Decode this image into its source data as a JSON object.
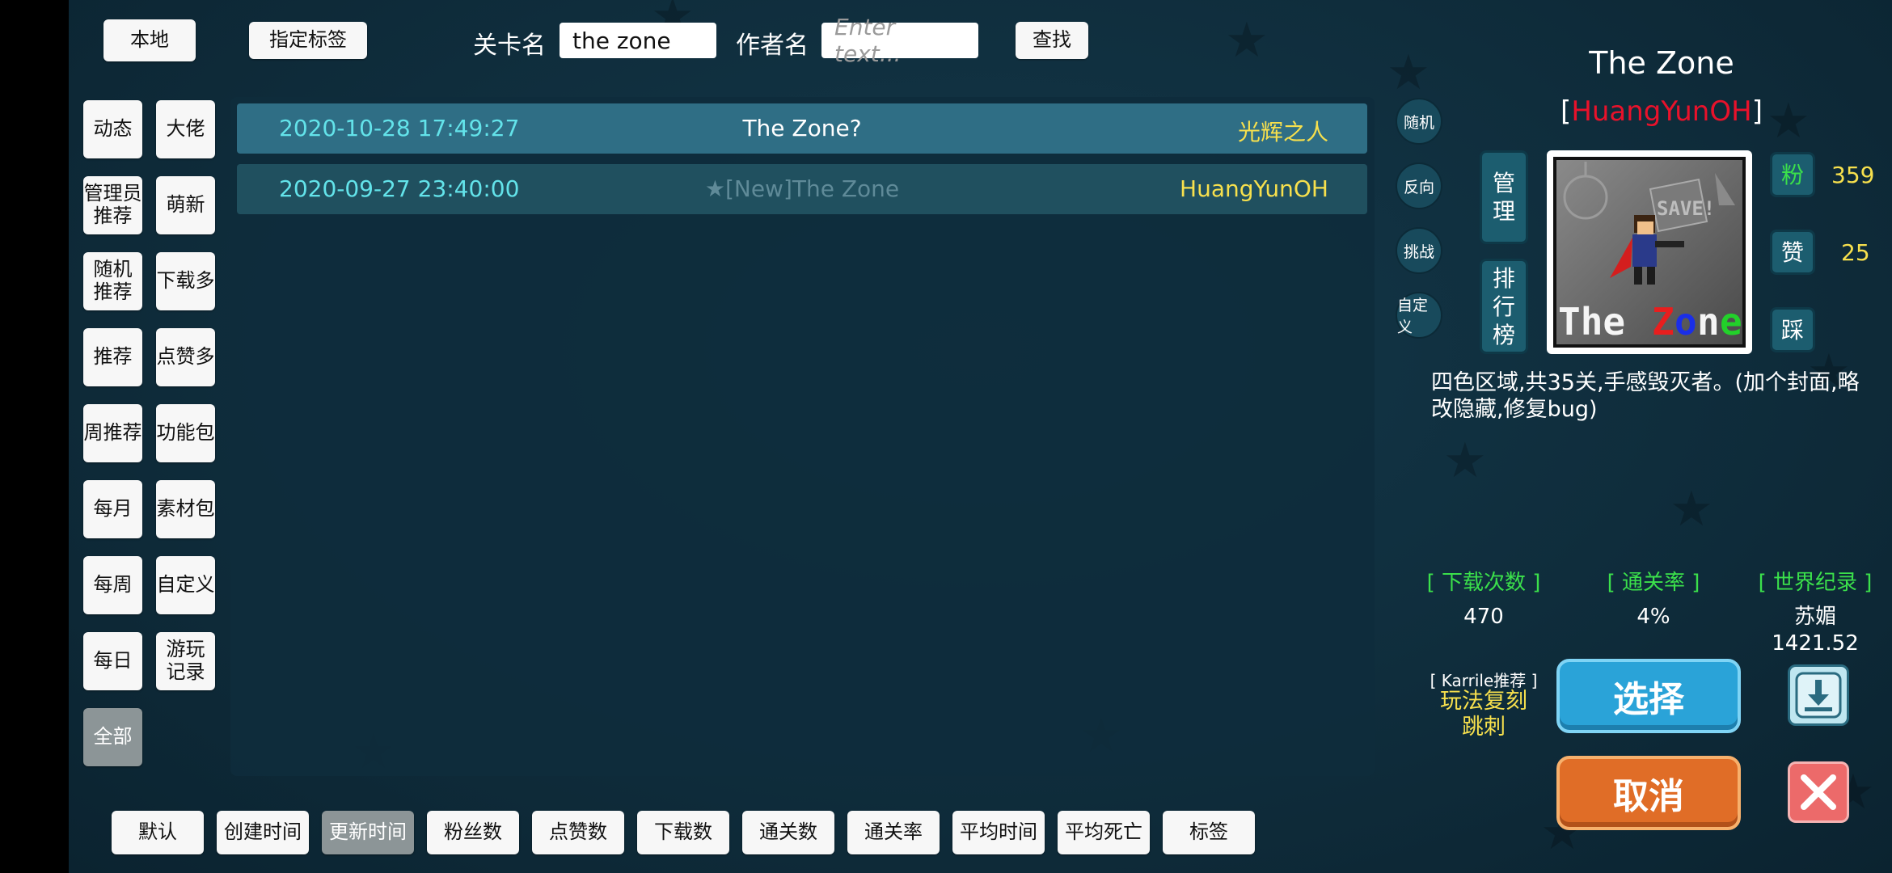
{
  "top_bar": {
    "local_button": "本地",
    "tag_button": "指定标签",
    "level_name_label": "关卡名",
    "level_name_value": "the zone",
    "author_label": "作者名",
    "author_placeholder": "Enter text...",
    "search_button": "查找"
  },
  "sidebar": {
    "left_column": [
      "动态",
      "管理员\n推荐",
      "随机\n推荐",
      "推荐",
      "周推荐",
      "每月",
      "每周",
      "每日",
      "全部"
    ],
    "right_column": [
      "大佬",
      "萌新",
      "下载多",
      "点赞多",
      "功能包",
      "素材包",
      "自定义",
      "游玩\n记录"
    ],
    "active": "全部"
  },
  "levels": [
    {
      "date": "2020-10-28 17:49:27",
      "title": "The Zone?",
      "author": "光辉之人"
    },
    {
      "date": "2020-09-27 23:40:00",
      "title": "★[New]The Zone",
      "author": "HuangYunOH"
    }
  ],
  "side_circles": [
    "随机",
    "反向",
    "挑战",
    "自定义"
  ],
  "detail": {
    "title": "The Zone",
    "author_bracket_open": "[",
    "author": "HuangYunOH",
    "author_bracket_close": "]",
    "manage_button": "管\n理",
    "rank_button": "排\n行\n榜",
    "thumbnail": {
      "word1": "The ",
      "letters": [
        "Z",
        "o",
        "n",
        "e"
      ],
      "letter_colors": [
        "#e81e1e",
        "#1a2ee8",
        "#f5f5f5",
        "#22d12a"
      ],
      "sign_text": "SAVE!"
    },
    "fans_button": "粉",
    "fans_count": "359",
    "likes_button": "赞",
    "likes_count": "25",
    "dislike_button": "踩",
    "description": "四色区域,共35关,手感毁灭者。(加个封面,略改隐藏,修复bug)",
    "stats": [
      {
        "header": "[ 下载次数 ]",
        "value": "470"
      },
      {
        "header": "[ 通关率 ]",
        "value": "4%"
      },
      {
        "header": "[ 世界纪录 ]",
        "value": "苏媚\n1421.52"
      }
    ],
    "recommend_label": "[ Karrile推荐 ]",
    "recommend_tags": "玩法复刻\n跳刺",
    "select_button": "选择",
    "cancel_button": "取消"
  },
  "sort_bar": {
    "items": [
      "默认",
      "创建时间",
      "更新时间",
      "粉丝数",
      "点赞数",
      "下载数",
      "通关数",
      "通关率",
      "平均时间",
      "平均死亡",
      "标签"
    ],
    "active": "更新时间"
  },
  "colors": {
    "date": "#63e3ea",
    "author_yellow": "#f7e04d",
    "author_red": "#e8122b",
    "stat_green": "#3be04b",
    "count_yellow": "#f7e04d",
    "select_blue": "#2aa3d8",
    "cancel_orange": "#e06d27",
    "close_red": "#ec6a6a"
  }
}
